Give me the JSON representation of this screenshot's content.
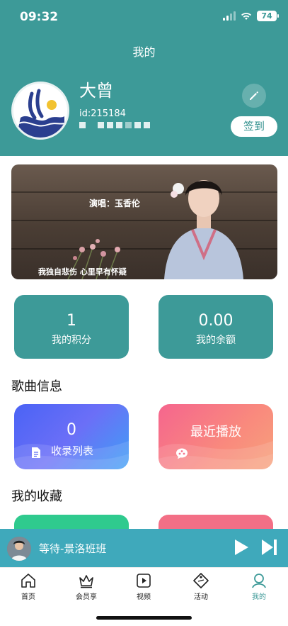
{
  "status_bar": {
    "time": "09:32",
    "battery": "74"
  },
  "header": {
    "title": "我的"
  },
  "profile": {
    "name": "大曾",
    "id_text": "id:215184",
    "signin_label": "签到"
  },
  "banner": {
    "singer_text": "演唱：玉香伦",
    "lyric_text": "我独自悲伤 心里早有怀疑"
  },
  "stats": [
    {
      "value": "1",
      "label": "我的积分"
    },
    {
      "value": "0.00",
      "label": "我的余额"
    }
  ],
  "song_info": {
    "title": "歌曲信息",
    "tiles": [
      {
        "count": "0",
        "label": "收录列表"
      },
      {
        "label": "最近播放"
      }
    ]
  },
  "favorites": {
    "title": "我的收藏"
  },
  "player": {
    "title": "等待-景洛班班"
  },
  "tabbar": {
    "items": [
      {
        "label": "首页",
        "icon": "home-icon"
      },
      {
        "label": "会员享",
        "icon": "crown-icon"
      },
      {
        "label": "视频",
        "icon": "video-icon"
      },
      {
        "label": "活动",
        "icon": "ticket-icon"
      },
      {
        "label": "我的",
        "icon": "user-icon"
      }
    ],
    "active": 4
  },
  "colors": {
    "primary": "#3d9a98",
    "player": "#3fa9bb",
    "tile_blue": "#4a63f5",
    "tile_pink": "#f5658e"
  }
}
